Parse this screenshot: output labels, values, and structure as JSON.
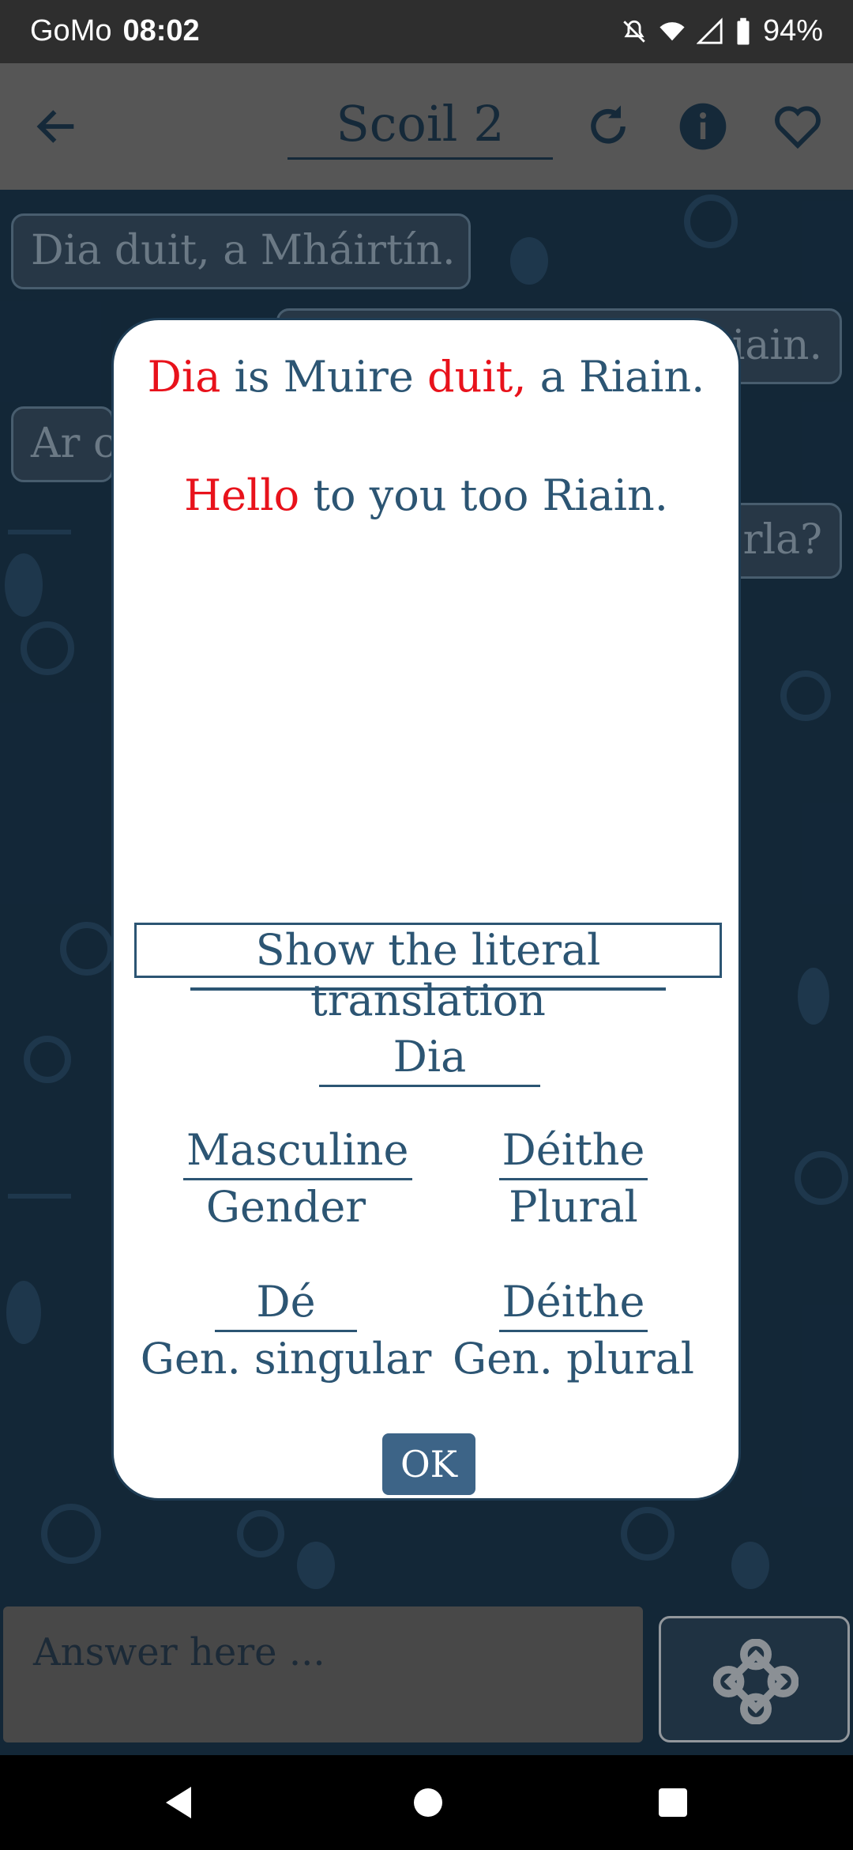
{
  "status_bar": {
    "carrier": "GoMo",
    "time": "08:02",
    "battery": "94%"
  },
  "app_bar": {
    "title": "Scoil 2"
  },
  "chat": {
    "bubbles": [
      "Dia duit, a Mháirtín.",
      "iain.",
      "Ar c",
      "rla?"
    ]
  },
  "dialog": {
    "line1": [
      {
        "text": "Dia",
        "color": "#e8121b"
      },
      {
        "text": " is Muire ",
        "color": "#2c5573"
      },
      {
        "text": "duit,",
        "color": "#e8121b"
      },
      {
        "text": " a Riain.",
        "color": "#2c5573"
      }
    ],
    "line2": [
      {
        "text": "Hello",
        "color": "#e8121b"
      },
      {
        "text": " to you too Riain.",
        "color": "#2c5573"
      }
    ],
    "literal_button": "Show the literal translation",
    "word": "Dia",
    "gender_value": "Masculine",
    "gender_label": "Gender",
    "plural_value": "Déithe",
    "plural_label": "Plural",
    "gen_singular_value": "Dé",
    "gen_singular_label": "Gen. singular",
    "gen_plural_value": "Déithe",
    "gen_plural_label": "Gen. plural",
    "ok_label": "OK"
  },
  "input": {
    "placeholder": "Answer here ..."
  },
  "icons": {
    "back": "arrow-back-icon",
    "refresh": "refresh-icon",
    "info": "info-icon",
    "favorite": "heart-icon",
    "send": "celtic-knot-icon",
    "nav_back": "triangle-back-icon",
    "nav_home": "circle-home-icon",
    "nav_recent": "square-recent-icon"
  }
}
